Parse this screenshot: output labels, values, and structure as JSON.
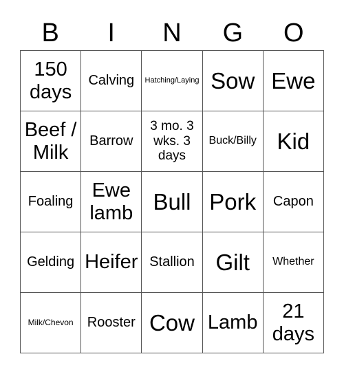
{
  "header": [
    "B",
    "I",
    "N",
    "G",
    "O"
  ],
  "cells": [
    [
      "150 days",
      "Calving",
      "Hatching/Laying",
      "Sow",
      "Ewe"
    ],
    [
      "Beef / Milk",
      "Barrow",
      "3 mo. 3 wks. 3 days",
      "Buck/Billy",
      "Kid"
    ],
    [
      "Foaling",
      "Ewe lamb",
      "Bull",
      "Pork",
      "Capon"
    ],
    [
      "Gelding",
      "Heifer",
      "Stallion",
      "Gilt",
      "Whether"
    ],
    [
      "Milk/Chevon",
      "Rooster",
      "Cow",
      "Lamb",
      "21 days"
    ]
  ]
}
